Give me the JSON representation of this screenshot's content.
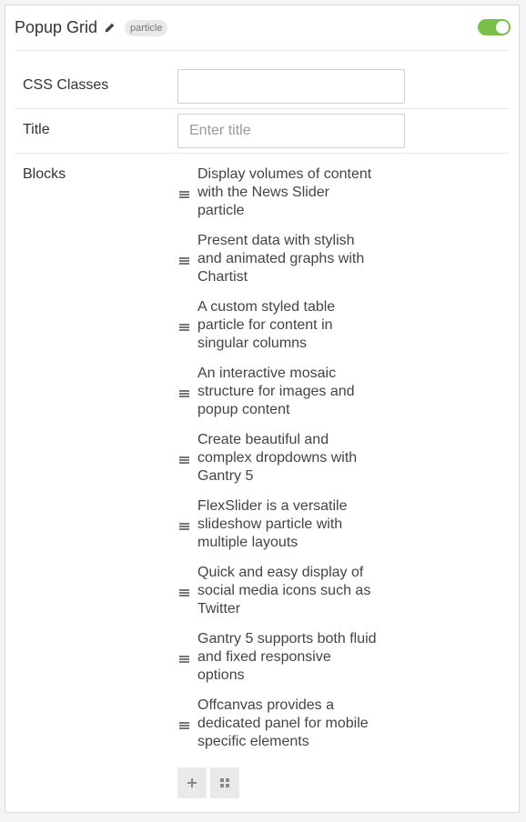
{
  "header": {
    "title": "Popup Grid",
    "badge": "particle",
    "enabled": true
  },
  "fields": {
    "css_classes": {
      "label": "CSS Classes",
      "value": "",
      "placeholder": ""
    },
    "title": {
      "label": "Title",
      "value": "",
      "placeholder": "Enter title"
    },
    "blocks_label": "Blocks"
  },
  "blocks": [
    "Display volumes of content with the News Slider particle",
    "Present data with stylish and animated graphs with Chartist",
    "A custom styled table particle for content in singular columns",
    "An interactive mosaic structure for images and popup content",
    "Create beautiful and complex dropdowns with Gantry 5",
    "FlexSlider is a versatile slideshow particle with multiple layouts",
    "Quick and easy display of social media icons such as Twitter",
    "Gantry 5 supports both fluid and fixed responsive options",
    "Offcanvas provides a dedicated panel for mobile specific elements"
  ],
  "icons": {
    "edit": "pencil-icon",
    "drag": "drag-handle-icon",
    "add": "plus-icon",
    "grid": "grid-icon"
  },
  "colors": {
    "toggle_on": "#78c04a",
    "badge_bg": "#e9e9e9"
  }
}
